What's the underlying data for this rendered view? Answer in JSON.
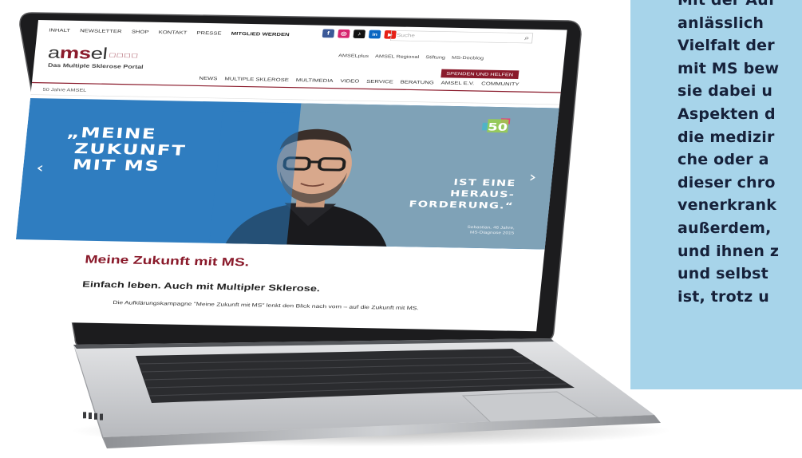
{
  "side_panel": {
    "lines": [
      "Mit der Auf",
      "anlässlich",
      "Vielfalt der",
      "mit MS bew",
      "sie dabei u",
      "Aspekten d",
      "die medizir",
      "che oder a",
      "dieser chro",
      "venerkrank",
      "außerdem,",
      "und ihnen z",
      "und selbst",
      "ist, trotz u"
    ]
  },
  "website": {
    "top_nav": [
      "INHALT",
      "NEWSLETTER",
      "SHOP",
      "KONTAKT",
      "PRESSE",
      "MITGLIED WERDEN"
    ],
    "social_icons": [
      {
        "name": "facebook-icon",
        "glyph": "f",
        "color": "#3b5998"
      },
      {
        "name": "instagram-icon",
        "glyph": "◎",
        "color": "#d6246e"
      },
      {
        "name": "tiktok-icon",
        "glyph": "♪",
        "color": "#111111"
      },
      {
        "name": "linkedin-icon",
        "glyph": "in",
        "color": "#0a66c2"
      },
      {
        "name": "youtube-icon",
        "glyph": "▶",
        "color": "#e62117"
      }
    ],
    "search": {
      "placeholder": "Suche"
    },
    "logo": {
      "prefix": "a",
      "bold": "ms",
      "suffix": "el",
      "tagline": "Das Multiple Sklerose Portal"
    },
    "sub_nav": [
      "AMSELplus",
      "AMSEL Regional",
      "Stiftung",
      "MS-Docblog"
    ],
    "donate_label": "SPENDEN UND HELFEN",
    "main_nav": [
      "NEWS",
      "MULTIPLE SKLEROSE",
      "MULTIMEDIA",
      "VIDEO",
      "SERVICE",
      "BERATUNG",
      "AMSEL E.V.",
      "COMMUNITY"
    ],
    "breadcrumb": "50 Jahre AMSEL",
    "hero": {
      "left_lines": [
        "„MEINE",
        "ZUKUNFT",
        "MIT MS"
      ],
      "right_lines": [
        "IST EINE",
        "HERAUS-",
        "FORDERUNG.“"
      ],
      "caption_lines": [
        "Sebastian, 46 Jahre,",
        "MS-Diagnose 2015"
      ],
      "badge": "50",
      "prev_arrow": "‹",
      "next_arrow": "›"
    },
    "headline": "Meine Zukunft mit MS.",
    "subheadline": "Einfach leben. Auch mit Multipler Sklerose.",
    "paragraph": "Die Aufklärungskampagne \"Meine Zukunft mit MS\" lenkt den Blick nach vorn – auf die Zukunft mit MS."
  },
  "colors": {
    "panel": "#a7d4ea",
    "brand": "#8a1a2b",
    "hero_blue": "#2f7dc0",
    "hero_grey": "#7fa2b7"
  }
}
